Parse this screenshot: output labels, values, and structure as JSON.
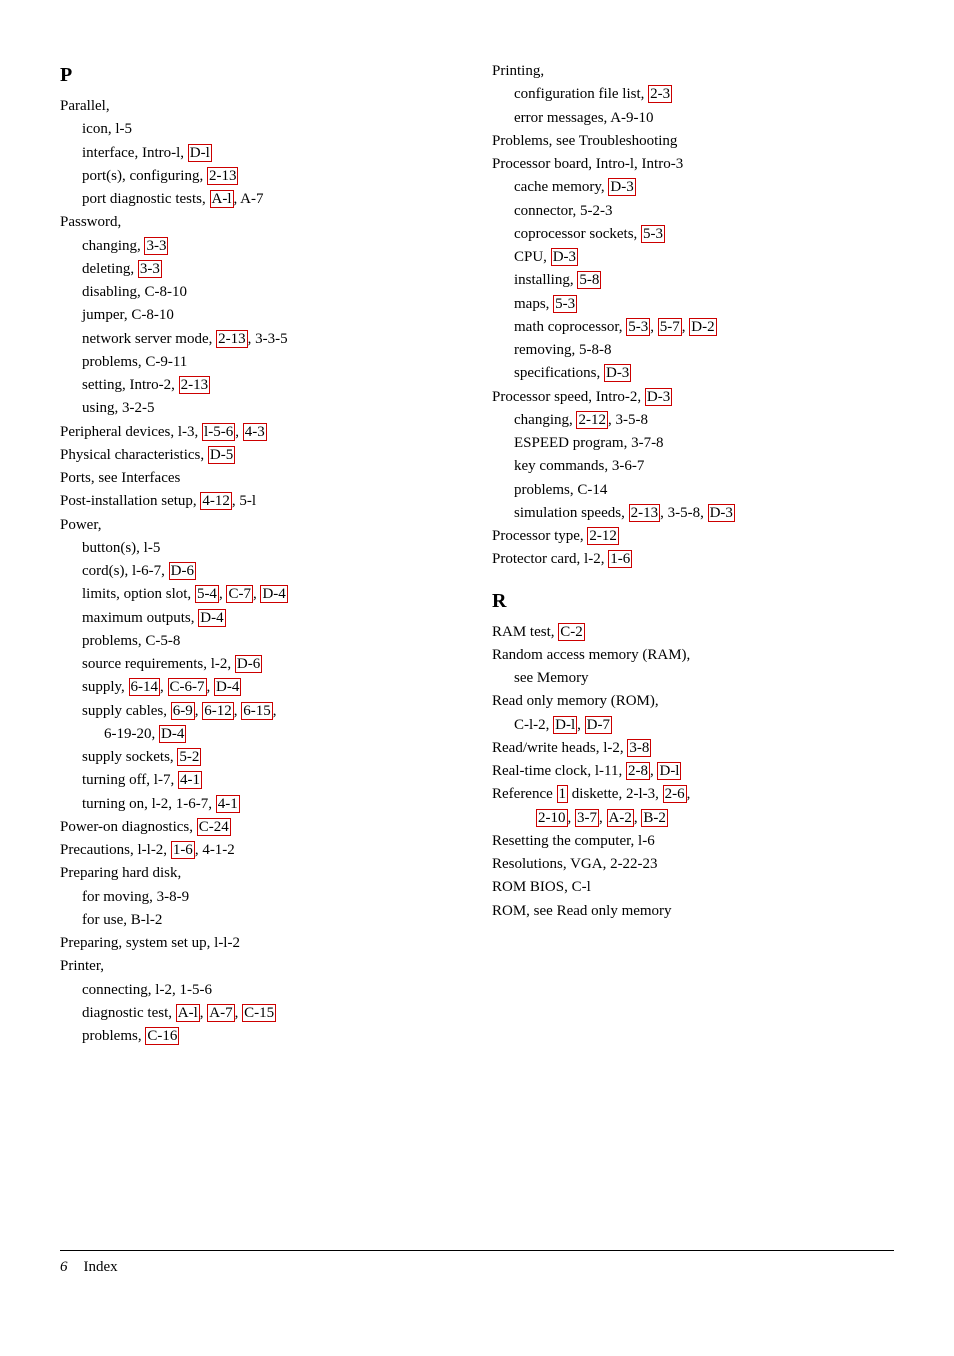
{
  "page": {
    "footer": {
      "number": "6",
      "label": "Index"
    }
  },
  "leftCol": {
    "sectionLetter": "P",
    "entries": [
      {
        "main": "Parallel,"
      },
      {
        "sub": "icon, l-5"
      },
      {
        "sub": "interface, Intro-l, ",
        "refs": [
          "D-l"
        ]
      },
      {
        "sub": "port(s), configuring, ",
        "refs": [
          "2-13"
        ]
      },
      {
        "sub": "port diagnostic tests, ",
        "refs": [
          "A-l"
        ],
        "after": ", A-7"
      },
      {
        "main": "Password,"
      },
      {
        "sub": "changing, ",
        "refs": [
          "3-3"
        ]
      },
      {
        "sub": "deleting, ",
        "refs": [
          "3-3"
        ]
      },
      {
        "sub": "disabling, C-8-10"
      },
      {
        "sub": "jumper, C-8-10"
      },
      {
        "sub": "network server mode, ",
        "refs": [
          "2-13"
        ],
        "after": ", 3-3-5"
      },
      {
        "sub": "problems, C-9-11"
      },
      {
        "sub": "setting, Intro-2, ",
        "refs": [
          "2-13"
        ]
      },
      {
        "sub": "using, 3-2-5"
      },
      {
        "main": "Peripheral devices, l-3, ",
        "refs": [
          "l-5-6",
          "4-3"
        ]
      },
      {
        "main": "Physical characteristics, ",
        "refs": [
          "D-5"
        ]
      },
      {
        "main": "Ports, see Interfaces"
      },
      {
        "main": "Post-installation setup, ",
        "refs": [
          "4-12"
        ],
        "after": ", 5-l"
      },
      {
        "main": "Power,"
      },
      {
        "sub": "button(s), l-5"
      },
      {
        "sub": "cord(s), l-6-7, ",
        "refs": [
          "D-6"
        ]
      },
      {
        "sub": "limits, option slot, ",
        "refs": [
          "5-4",
          "C-7",
          "D-4"
        ]
      },
      {
        "sub": "maximum outputs, ",
        "refs": [
          "D-4"
        ]
      },
      {
        "sub": "problems, C-5-8"
      },
      {
        "sub": "source requirements, l-2, ",
        "refs": [
          "D-6"
        ]
      },
      {
        "sub": "supply, ",
        "refs": [
          "6-14",
          "C-6-7",
          "D-4"
        ]
      },
      {
        "sub": "supply cables, ",
        "refs": [
          "6-9",
          "6-12",
          "6-15"
        ],
        "after": ", 6-19-20, ",
        "refs2": [
          "D-4"
        ]
      },
      {
        "sub": "supply sockets, ",
        "refs": [
          "5-2"
        ]
      },
      {
        "sub": "turning off, l-7, ",
        "refs": [
          "4-1"
        ]
      },
      {
        "sub": "turning on, l-2, 1-6-7, ",
        "refs": [
          "4-1"
        ]
      },
      {
        "main": "Power-on diagnostics, ",
        "refs": [
          "C-24"
        ]
      },
      {
        "main": "Precautions, l-l-2, ",
        "refs": [
          "1-6"
        ],
        "after": ", 4-1-2"
      },
      {
        "main": "Preparing hard disk,"
      },
      {
        "sub": "for moving, 3-8-9"
      },
      {
        "sub": "for use, B-l-2"
      },
      {
        "main": "Preparing, system set up, l-l-2"
      },
      {
        "main": "Printer,"
      },
      {
        "sub": "connecting, l-2, 1-5-6"
      },
      {
        "sub": "diagnostic test, ",
        "refs": [
          "A-l",
          "A-7",
          "C-15"
        ]
      },
      {
        "sub": "problems, ",
        "refs": [
          "C-16"
        ]
      }
    ]
  },
  "rightCol": {
    "entries": [
      {
        "main": "Printing,"
      },
      {
        "sub": "configuration file list, ",
        "refs": [
          "2-3"
        ]
      },
      {
        "sub": "error messages, A-9-10"
      },
      {
        "main": "Problems, see Troubleshooting"
      },
      {
        "main": "Processor board, Intro-l, Intro-3"
      },
      {
        "sub": "cache memory, ",
        "refs": [
          "D-3"
        ]
      },
      {
        "sub": "connector, 5-2-3"
      },
      {
        "sub": "coprocessor sockets, ",
        "refs": [
          "5-3"
        ]
      },
      {
        "sub": "CPU, ",
        "refs": [
          "D-3"
        ]
      },
      {
        "sub": "installing, ",
        "refs": [
          "5-8"
        ]
      },
      {
        "sub": "maps, ",
        "refs": [
          "5-3"
        ]
      },
      {
        "sub": "math coprocessor, ",
        "refs": [
          "5-3",
          "5-7",
          "D-2"
        ]
      },
      {
        "sub": "removing, 5-8-8"
      },
      {
        "sub": "specifications, ",
        "refs": [
          "D-3"
        ]
      },
      {
        "main": "Processor speed, Intro-2, ",
        "refs": [
          "D-3"
        ]
      },
      {
        "sub": "changing, ",
        "refs": [
          "2-12"
        ],
        "after": ", 3-5-8"
      },
      {
        "sub": "ESPEED program, 3-7-8"
      },
      {
        "sub": "key commands, 3-6-7"
      },
      {
        "sub": "problems, C-14"
      },
      {
        "sub": "simulation speeds, ",
        "refs": [
          "2-13"
        ],
        "after": ", 3-5-8, ",
        "refs2": [
          "D-3"
        ]
      },
      {
        "main": "Processor type, ",
        "refs": [
          "2-12"
        ]
      },
      {
        "main": "Protector card, l-2, ",
        "refs": [
          "1-6"
        ]
      }
    ],
    "sectionR": {
      "letter": "R",
      "entries": [
        {
          "main": "RAM test, ",
          "refs": [
            "C-2"
          ]
        },
        {
          "main": "Random access memory (RAM),"
        },
        {
          "sub": "see Memory"
        },
        {
          "main": "Read only memory (ROM),"
        },
        {
          "sub": "C-l-2, ",
          "refs": [
            "D-l",
            "D-7"
          ]
        },
        {
          "main": "Read/write heads, l-2, ",
          "refs": [
            "3-8"
          ]
        },
        {
          "main": "Real-time clock, l-11, ",
          "refs": [
            "2-8",
            "D-l"
          ]
        },
        {
          "main": "Reference ",
          "refs": [
            "1"
          ],
          "after": " diskette, 2-l-3, ",
          "refs2": [
            "2-6",
            "2-10",
            "3-7",
            "A-2",
            "B-2"
          ]
        },
        {
          "main": "Resetting the computer, l-6"
        },
        {
          "main": "Resolutions, VGA, 2-22-23"
        },
        {
          "main": "ROM BIOS, C-l"
        },
        {
          "main": "ROM, see Read only memory"
        }
      ]
    }
  }
}
